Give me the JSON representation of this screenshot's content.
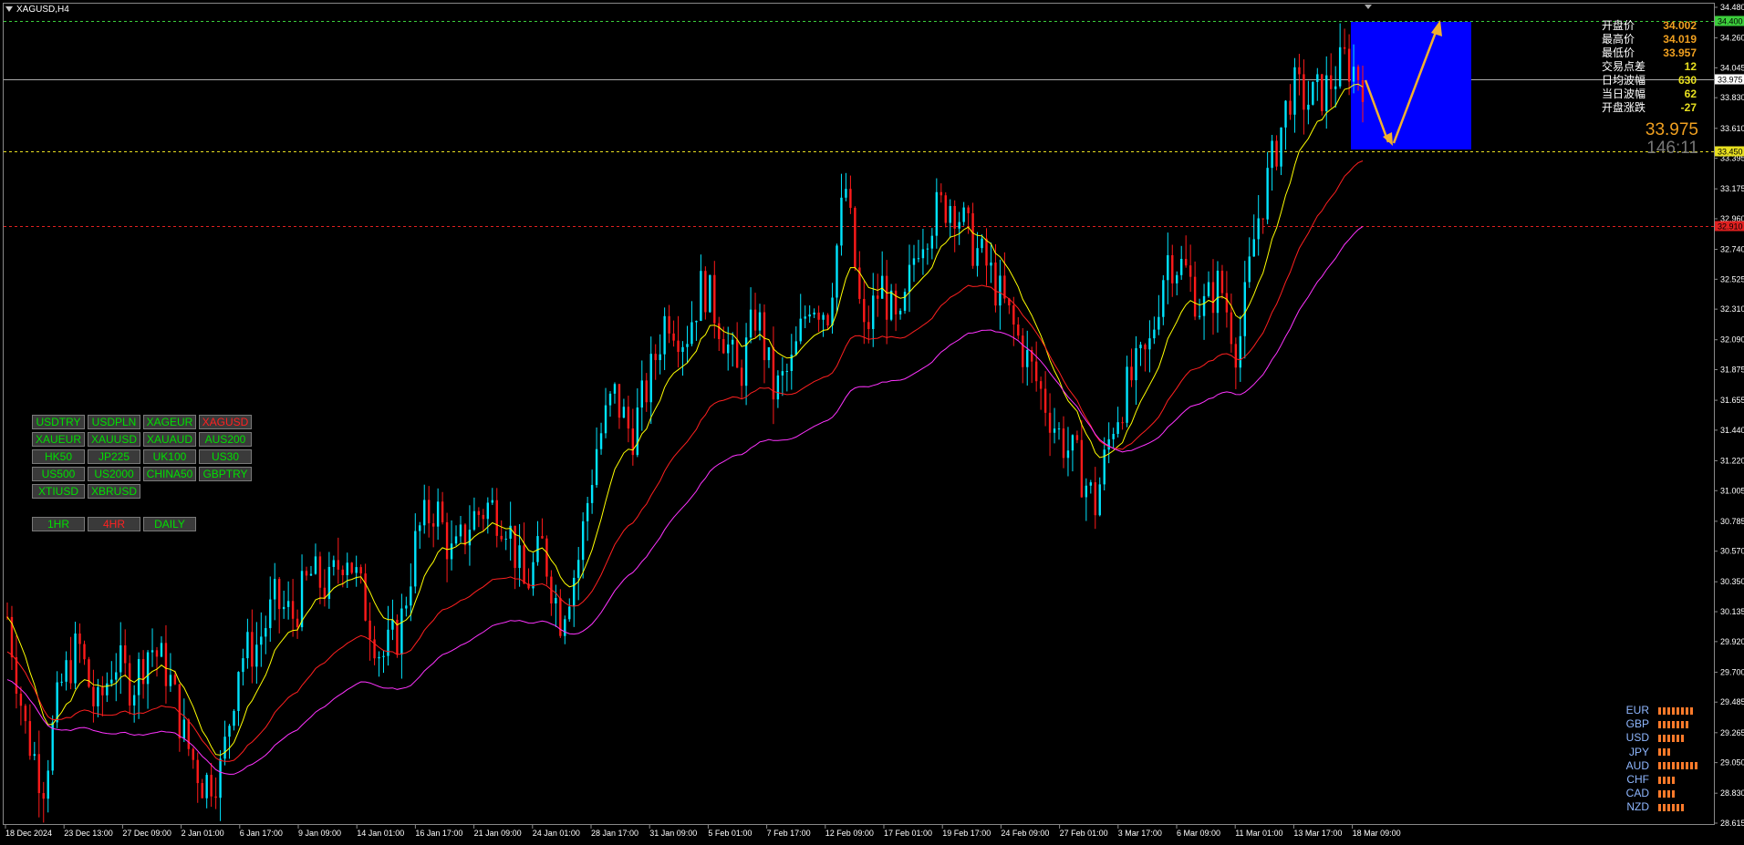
{
  "window": {
    "symbol_title": "XAGUSD,H4"
  },
  "price_axis": {
    "ticks": [
      "34.480",
      "34.260",
      "34.045",
      "33.830",
      "33.610",
      "33.395",
      "33.175",
      "32.960",
      "32.740",
      "32.525",
      "32.310",
      "32.090",
      "31.875",
      "31.655",
      "31.440",
      "31.220",
      "31.005",
      "30.785",
      "30.570",
      "30.350",
      "30.135",
      "29.920",
      "29.700",
      "29.485",
      "29.265",
      "29.050",
      "28.830",
      "28.615"
    ],
    "current_price_label": "33.975",
    "green_line_label": "34.400",
    "yellow_line_label": "33.450",
    "red_line_label": "32.910"
  },
  "time_axis": {
    "labels": [
      "18 Dec 2024",
      "23 Dec 13:00",
      "27 Dec 09:00",
      "2 Jan 01:00",
      "6 Jan 17:00",
      "9 Jan 09:00",
      "14 Jan 01:00",
      "16 Jan 17:00",
      "21 Jan 09:00",
      "24 Jan 01:00",
      "28 Jan 17:00",
      "31 Jan 09:00",
      "5 Feb 01:00",
      "7 Feb 17:00",
      "12 Feb 09:00",
      "17 Feb 01:00",
      "19 Feb 17:00",
      "24 Feb 09:00",
      "27 Feb 01:00",
      "3 Mar 17:00",
      "6 Mar 09:00",
      "11 Mar 01:00",
      "13 Mar 17:00",
      "18 Mar 09:00"
    ]
  },
  "symbol_buttons": [
    {
      "label": "USDTRY",
      "active": false
    },
    {
      "label": "USDPLN",
      "active": false
    },
    {
      "label": "XAGEUR",
      "active": false
    },
    {
      "label": "XAGUSD",
      "active": true
    },
    {
      "label": "XAUEUR",
      "active": false
    },
    {
      "label": "XAUUSD",
      "active": false
    },
    {
      "label": "XAUAUD",
      "active": false
    },
    {
      "label": "AUS200",
      "active": false
    },
    {
      "label": "HK50",
      "active": false
    },
    {
      "label": "JP225",
      "active": false
    },
    {
      "label": "UK100",
      "active": false
    },
    {
      "label": "US30",
      "active": false
    },
    {
      "label": "US500",
      "active": false
    },
    {
      "label": "US2000",
      "active": false
    },
    {
      "label": "CHINA50",
      "active": false
    },
    {
      "label": "GBPTRY",
      "active": false
    },
    {
      "label": "XTIUSD",
      "active": false
    },
    {
      "label": "XBRUSD",
      "active": false
    }
  ],
  "timeframe_buttons": [
    {
      "label": "1HR",
      "active": false
    },
    {
      "label": "4HR",
      "active": true
    },
    {
      "label": "DAILY",
      "active": false
    }
  ],
  "info_panel": [
    {
      "label": "开盘价",
      "value": "34.002",
      "color": "#f0a020"
    },
    {
      "label": "最高价",
      "value": "34.019",
      "color": "#f0a020"
    },
    {
      "label": "最低价",
      "value": "33.957",
      "color": "#f0a020"
    },
    {
      "label": "交易点差",
      "value": "12",
      "color": "#e8e020"
    },
    {
      "label": "日均波幅",
      "value": "630",
      "color": "#e8e020"
    },
    {
      "label": "当日波幅",
      "value": "62",
      "color": "#e8e020"
    },
    {
      "label": "开盘涨跌",
      "value": "-27",
      "color": "#e8e020"
    }
  ],
  "big_price": "33.975",
  "candle_timer": "146:11",
  "currency_strength": [
    {
      "currency": "EUR",
      "bars": 8
    },
    {
      "currency": "GBP",
      "bars": 7
    },
    {
      "currency": "USD",
      "bars": 6
    },
    {
      "currency": "JPY",
      "bars": 3
    },
    {
      "currency": "AUD",
      "bars": 9
    },
    {
      "currency": "CHF",
      "bars": 4
    },
    {
      "currency": "CAD",
      "bars": 4
    },
    {
      "currency": "NZD",
      "bars": 6
    }
  ],
  "colors": {
    "bull_candle": "#00e5ff",
    "bear_candle": "#ff1a1a",
    "ma_fast": "#ffff00",
    "ma_mid": "#ff2020",
    "ma_slow": "#ff33ff",
    "target_box": "#0000ff",
    "arrow": "#f0b030"
  },
  "chart_data": {
    "type": "candlestick",
    "symbol": "XAGUSD",
    "timeframe": "H4",
    "ylim": [
      28.615,
      34.48
    ],
    "horizontal_levels": [
      34.4,
      33.975,
      33.45,
      32.91
    ],
    "price_path": [
      30.1,
      29.3,
      28.9,
      29.6,
      29.9,
      29.4,
      29.8,
      29.6,
      29.9,
      29.7,
      29.2,
      28.9,
      29.0,
      29.8,
      29.9,
      30.2,
      30.1,
      30.4,
      30.3,
      30.6,
      30.2,
      29.8,
      30.0,
      30.7,
      30.9,
      30.5,
      30.8,
      30.9,
      30.8,
      30.3,
      30.6,
      30.1,
      30.5,
      31.3,
      31.7,
      31.4,
      31.8,
      32.3,
      32.1,
      32.5,
      32.2,
      31.8,
      32.3,
      31.7,
      31.9,
      32.4,
      32.3,
      33.2,
      32.1,
      32.5,
      32.1,
      32.8,
      33.0,
      33.1,
      32.8,
      32.6,
      32.3,
      32.0,
      31.7,
      31.4,
      31.2,
      30.9,
      31.5,
      31.8,
      32.0,
      32.7,
      32.6,
      32.3,
      32.5,
      32.0,
      32.9,
      33.4,
      33.9,
      33.8,
      33.9,
      34.1,
      33.97
    ]
  }
}
